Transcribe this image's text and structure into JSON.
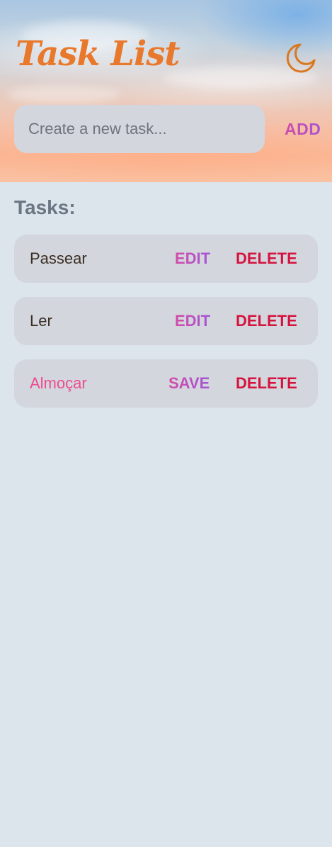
{
  "header": {
    "title": "Task List",
    "theme_toggle_icon": "moon-icon"
  },
  "new_task": {
    "placeholder": "Create a new task...",
    "value": "",
    "add_label": "ADD"
  },
  "tasks_section": {
    "heading": "Tasks:",
    "items": [
      {
        "text": "Passear",
        "action_label": "EDIT",
        "delete_label": "DELETE",
        "editing": false
      },
      {
        "text": "Ler",
        "action_label": "EDIT",
        "delete_label": "DELETE",
        "editing": false
      },
      {
        "text": "Almoçar",
        "action_label": "SAVE",
        "delete_label": "DELETE",
        "editing": true
      }
    ]
  },
  "colors": {
    "title": "#e8792c",
    "accent_gradient_start": "#d54aa6",
    "accent_gradient_end": "#a257d7",
    "delete": "#d5143e",
    "editing_text": "#ec4c8f",
    "page_background": "#dce4ec",
    "card_background": "#d3d6dd"
  }
}
